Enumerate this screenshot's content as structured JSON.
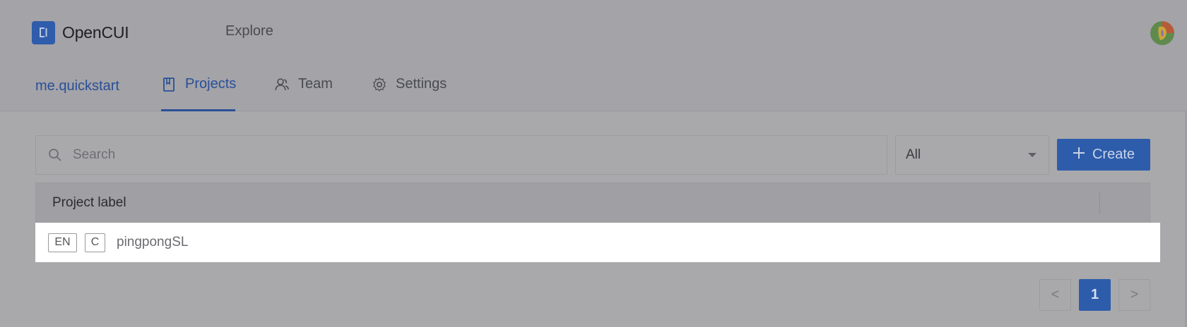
{
  "header": {
    "brand": "OpenCUI",
    "explore": "Explore"
  },
  "subnav": {
    "org": "me.quickstart",
    "tabs": [
      {
        "label": "Projects",
        "icon": "book-icon",
        "active": true
      },
      {
        "label": "Team",
        "icon": "users-icon",
        "active": false
      },
      {
        "label": "Settings",
        "icon": "gear-icon",
        "active": false
      }
    ]
  },
  "toolbar": {
    "search_placeholder": "Search",
    "filter_value": "All",
    "create_label": "Create"
  },
  "table": {
    "columns": [
      "Project label"
    ],
    "rows": [
      {
        "lang": "EN",
        "type": "C",
        "name": "pingpongSL"
      }
    ]
  },
  "pagination": {
    "prev": "<",
    "current": "1",
    "next": ">"
  },
  "colors": {
    "accent": "#2d5cab",
    "overlay": "#a9a9ab"
  }
}
